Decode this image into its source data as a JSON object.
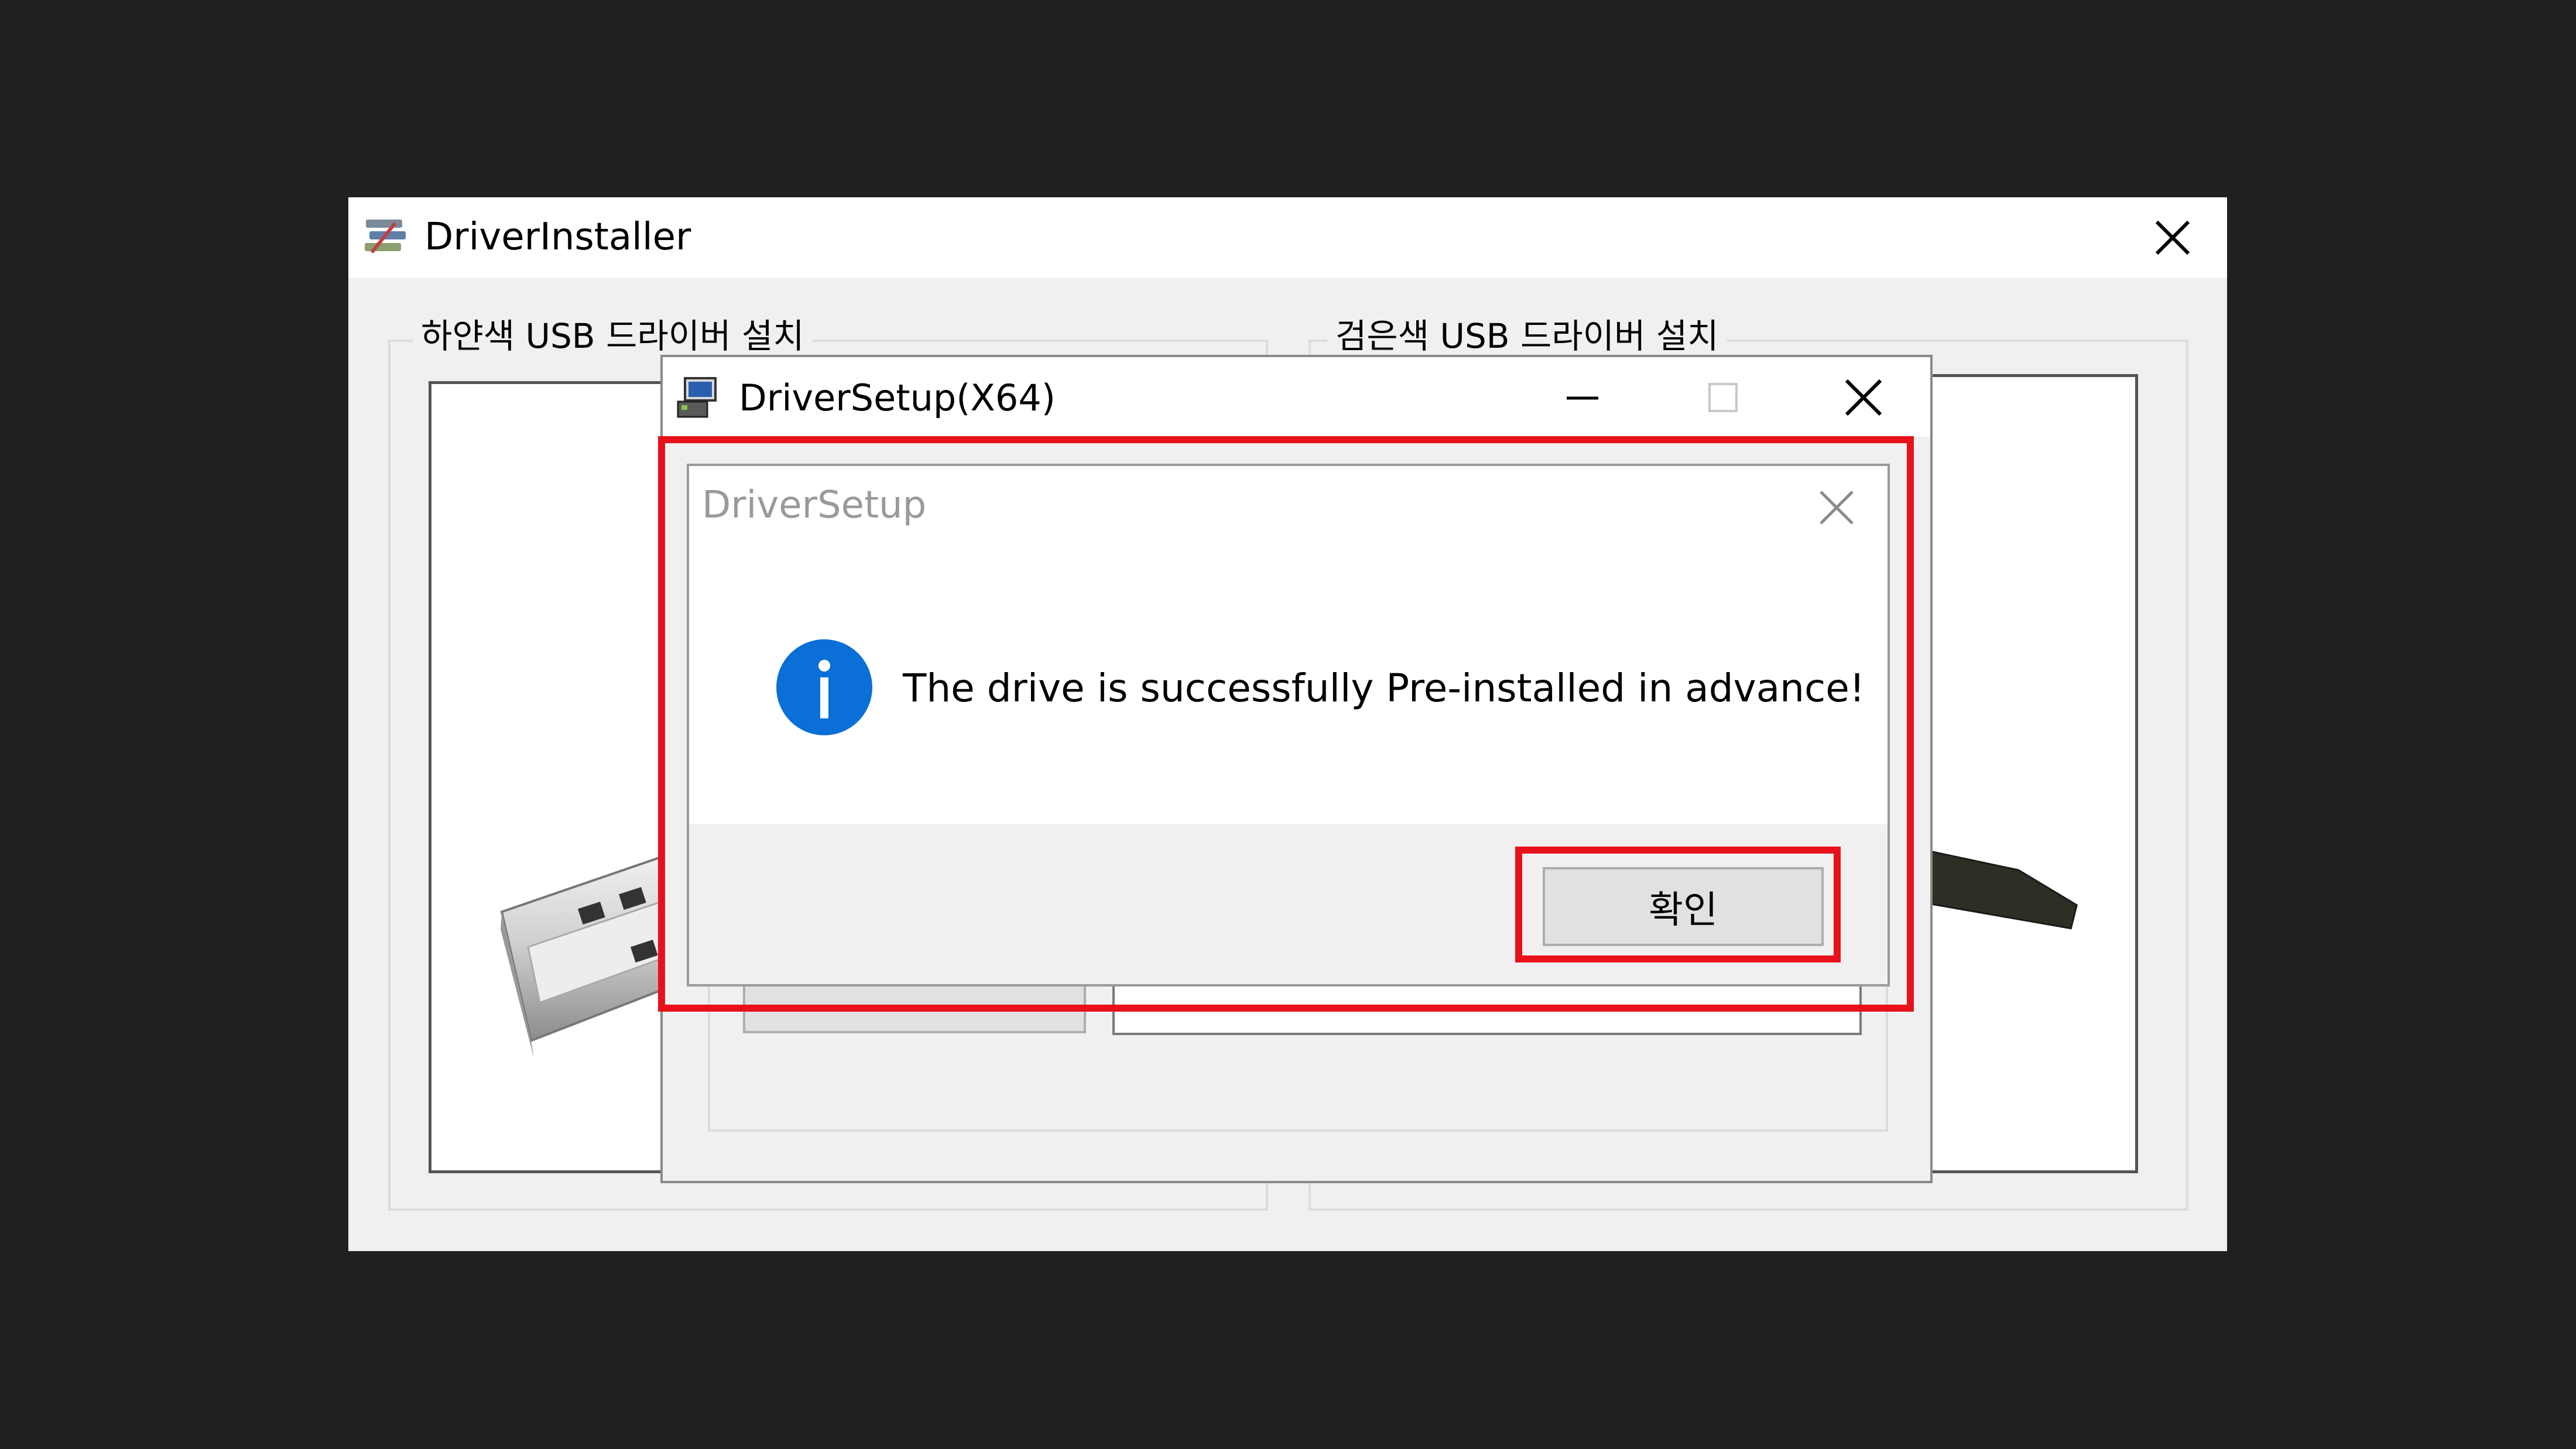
{
  "installer_window": {
    "title": "DriverInstaller",
    "groups": {
      "white_label": "하얀색 USB 드라이버 설치",
      "black_label": "검은색 USB 드라이버 설치"
    }
  },
  "setup_window": {
    "title": "DriverSetup(X64)"
  },
  "message_box": {
    "title": "DriverSetup",
    "message": "The drive is successfully Pre-installed in advance!",
    "ok_label": "확인",
    "icon": "info-icon"
  },
  "colors": {
    "background": "#202020",
    "highlight": "#e8101a",
    "info_blue": "#0a6fd6",
    "window_face": "#f0f0f0"
  }
}
